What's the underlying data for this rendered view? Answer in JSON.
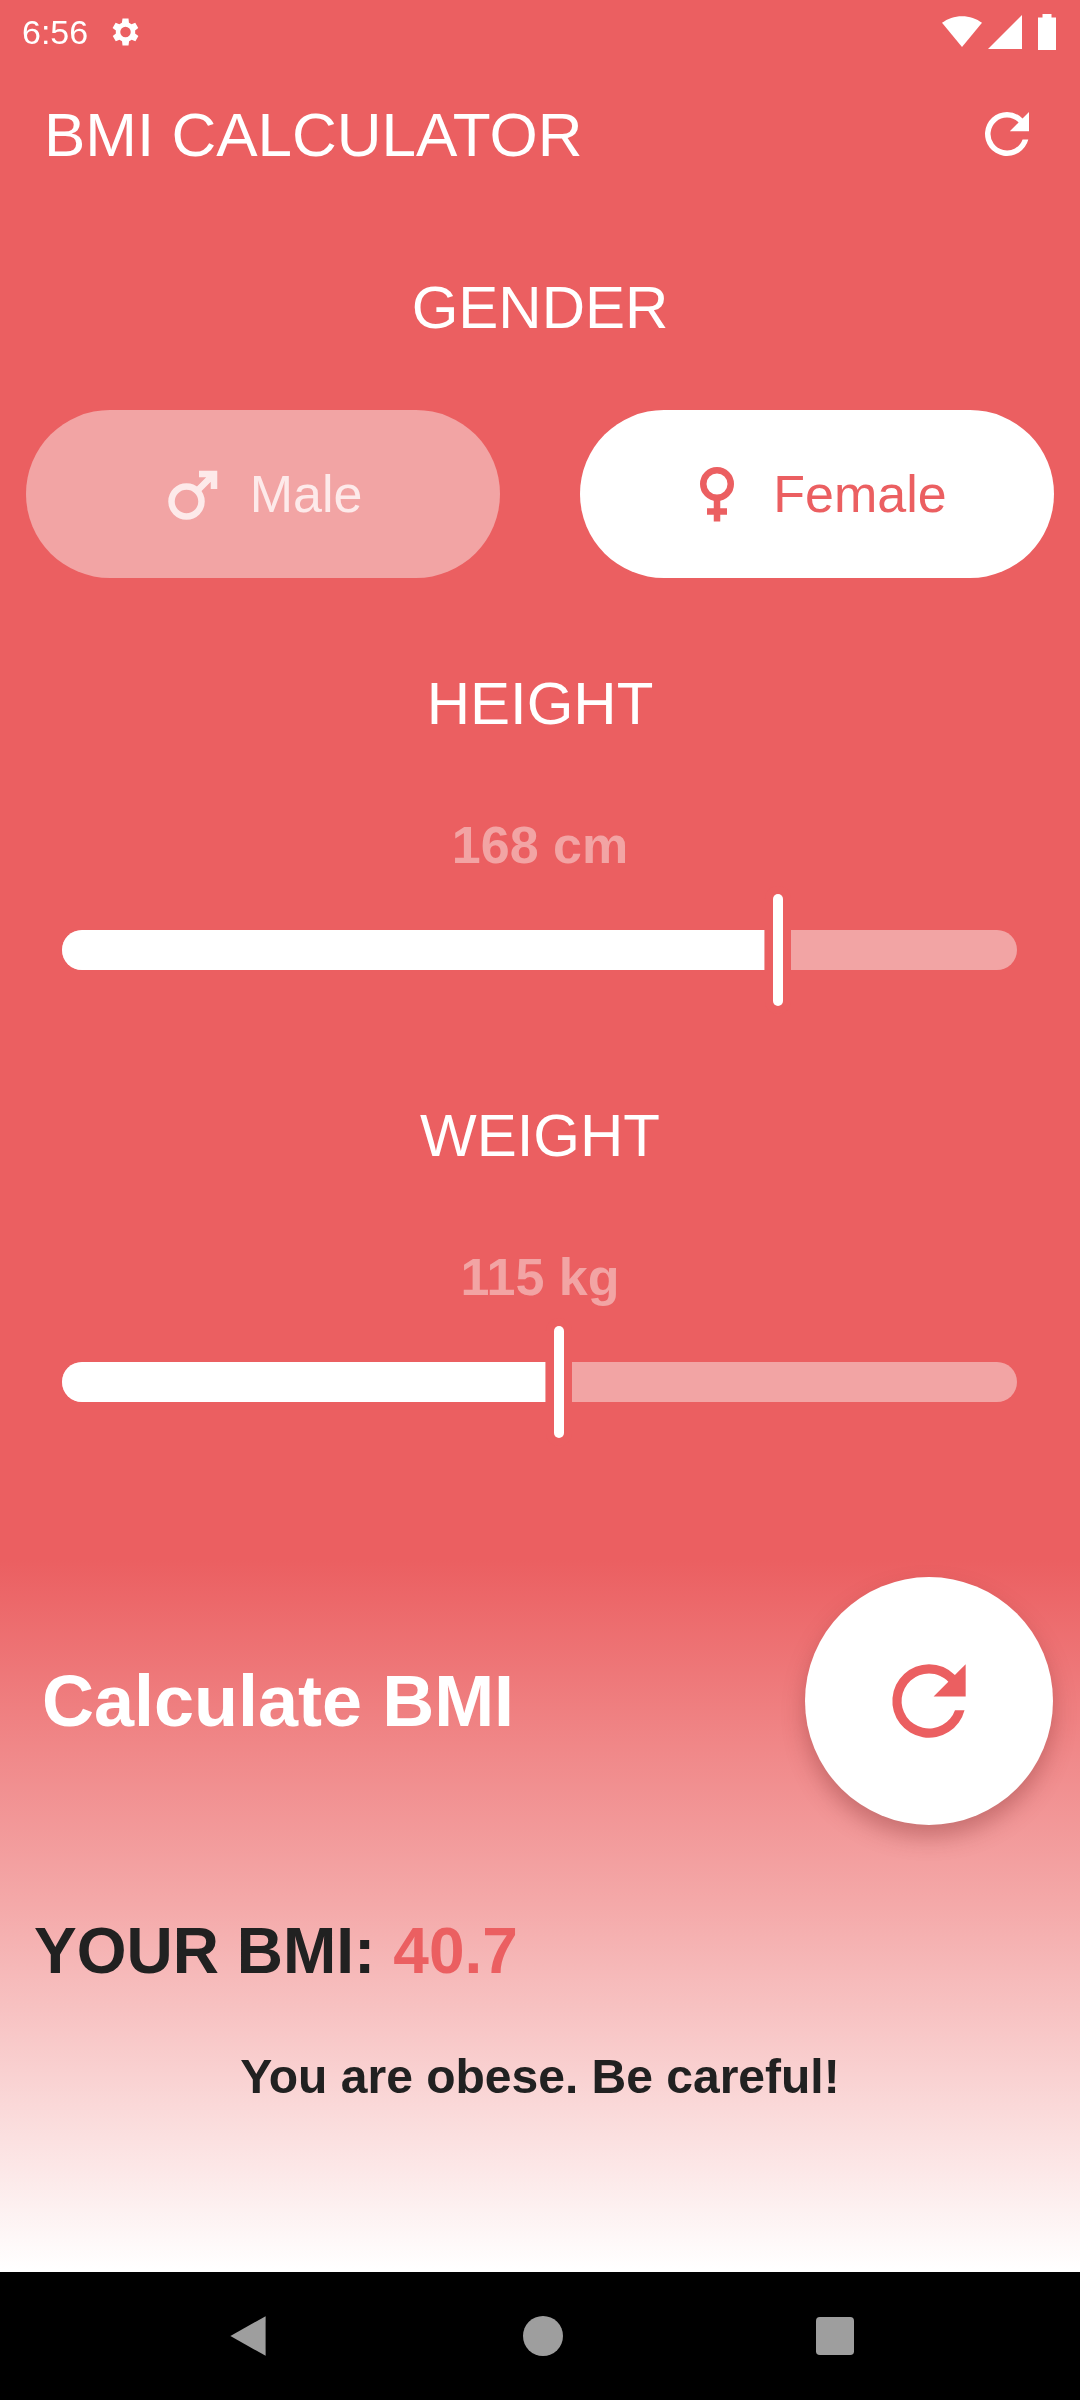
{
  "status_bar": {
    "time": "6:56"
  },
  "app_bar": {
    "title": "BMI CALCULATOR"
  },
  "gender": {
    "label": "GENDER",
    "options": [
      {
        "label": "Male",
        "kind": "male",
        "selected": false
      },
      {
        "label": "Female",
        "kind": "female",
        "selected": true
      }
    ]
  },
  "sliders": [
    {
      "label": "HEIGHT",
      "reading": "168 cm",
      "level": 0.75
    },
    {
      "label": "WEIGHT",
      "reading": "115 kg",
      "level": 0.52
    }
  ],
  "calculate": {
    "label": "Calculate BMI"
  },
  "result": {
    "label": "YOUR BMI:",
    "value": "40.7",
    "message": "You are obese. Be careful!"
  }
}
